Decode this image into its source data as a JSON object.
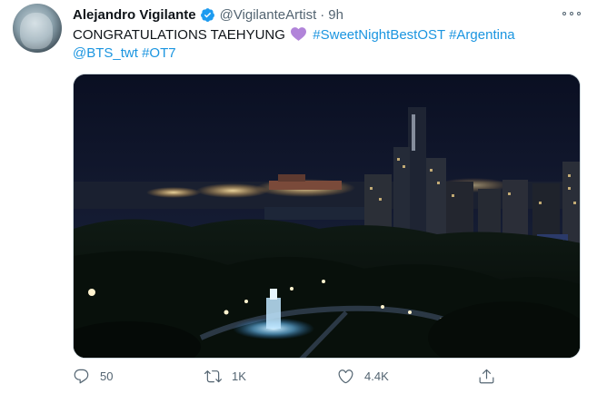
{
  "tweet": {
    "author": {
      "name": "Alejandro Vigilante",
      "handle": "@VigilanteArtist"
    },
    "separator": "·",
    "time": "9h",
    "text": {
      "prefix": "CONGRATULATIONS TAEHYUNG",
      "hashtag_1": "#SweetNightBestOST",
      "hashtag_2": "#Argentina",
      "mention": "@BTS_twt",
      "hashtag_3": "#OT7"
    },
    "stats": {
      "replies": "50",
      "retweets": "1K",
      "likes": "4.4K"
    }
  },
  "colors": {
    "link": "#1b95e0",
    "verified": "#1d9bf0",
    "heart": "#b184d9",
    "muted": "#536471"
  }
}
